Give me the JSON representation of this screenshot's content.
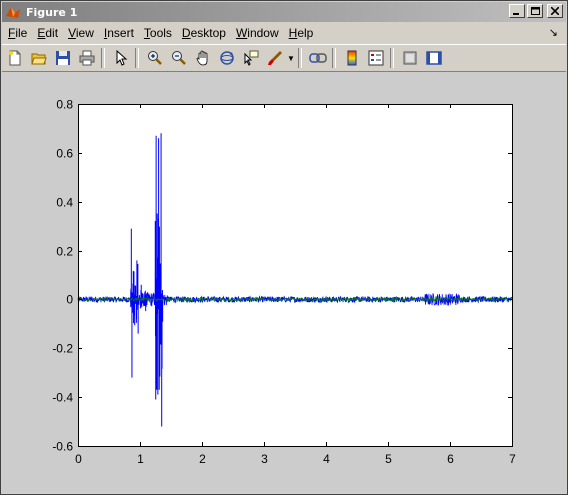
{
  "window": {
    "title": "Figure 1"
  },
  "menu": {
    "items": [
      {
        "key": "F",
        "rest": "ile"
      },
      {
        "key": "E",
        "rest": "dit"
      },
      {
        "key": "V",
        "rest": "iew"
      },
      {
        "key": "I",
        "rest": "nsert"
      },
      {
        "key": "T",
        "rest": "ools"
      },
      {
        "key": "D",
        "rest": "esktop"
      },
      {
        "key": "W",
        "rest": "indow"
      },
      {
        "key": "H",
        "rest": "elp"
      }
    ],
    "dock_arrow": "↘"
  },
  "toolbar": {
    "icons": [
      "new-figure-icon",
      "open-file-icon",
      "save-icon",
      "print-icon",
      "select-arrow-icon",
      "zoom-in-icon",
      "zoom-out-icon",
      "pan-hand-icon",
      "rotate-3d-icon",
      "data-cursor-icon",
      "brush-icon",
      "link-plot-icon",
      "colorbar-icon",
      "legend-icon",
      "hide-plot-tools-icon",
      "show-plot-tools-icon"
    ]
  },
  "colors": {
    "signal_primary": "#0000ff",
    "signal_secondary": "#008000",
    "figure_background": "#cccccc",
    "axes_background": "#ffffff"
  },
  "chart_data": {
    "type": "line",
    "title": "",
    "xlabel": "",
    "ylabel": "",
    "xlim": [
      0,
      7
    ],
    "ylim": [
      -0.6,
      0.8
    ],
    "xticks": [
      "0",
      "1",
      "2",
      "3",
      "4",
      "5",
      "6",
      "7"
    ],
    "yticks": [
      "0.8",
      "0.6",
      "0.4",
      "0.2",
      "0",
      "-0.2",
      "-0.4",
      "-0.6"
    ],
    "grid": false,
    "series": [
      {
        "color": "#0000ff",
        "description_points": [
          {
            "x": 0.0,
            "y": 0.0
          },
          {
            "x": 0.86,
            "y": 0.29
          },
          {
            "x": 0.87,
            "y": -0.32
          },
          {
            "x": 0.95,
            "y": 0.16
          },
          {
            "x": 0.97,
            "y": -0.14
          },
          {
            "x": 1.02,
            "y": 0.06
          },
          {
            "x": 1.12,
            "y": 0.03
          },
          {
            "x": 1.26,
            "y": 0.67
          },
          {
            "x": 1.27,
            "y": -0.37
          },
          {
            "x": 1.3,
            "y": 0.66
          },
          {
            "x": 1.31,
            "y": -0.37
          },
          {
            "x": 1.34,
            "y": 0.68
          },
          {
            "x": 1.35,
            "y": -0.52
          },
          {
            "x": 1.4,
            "y": 0.02
          },
          {
            "x": 7.0,
            "y": 0.0
          }
        ],
        "base_noise_amplitude": 0.012,
        "burst_region_x": [
          5.6,
          6.15
        ],
        "burst_region_amplitude": 0.025
      },
      {
        "color": "#008000",
        "base_noise_amplitude": 0.006
      }
    ]
  }
}
